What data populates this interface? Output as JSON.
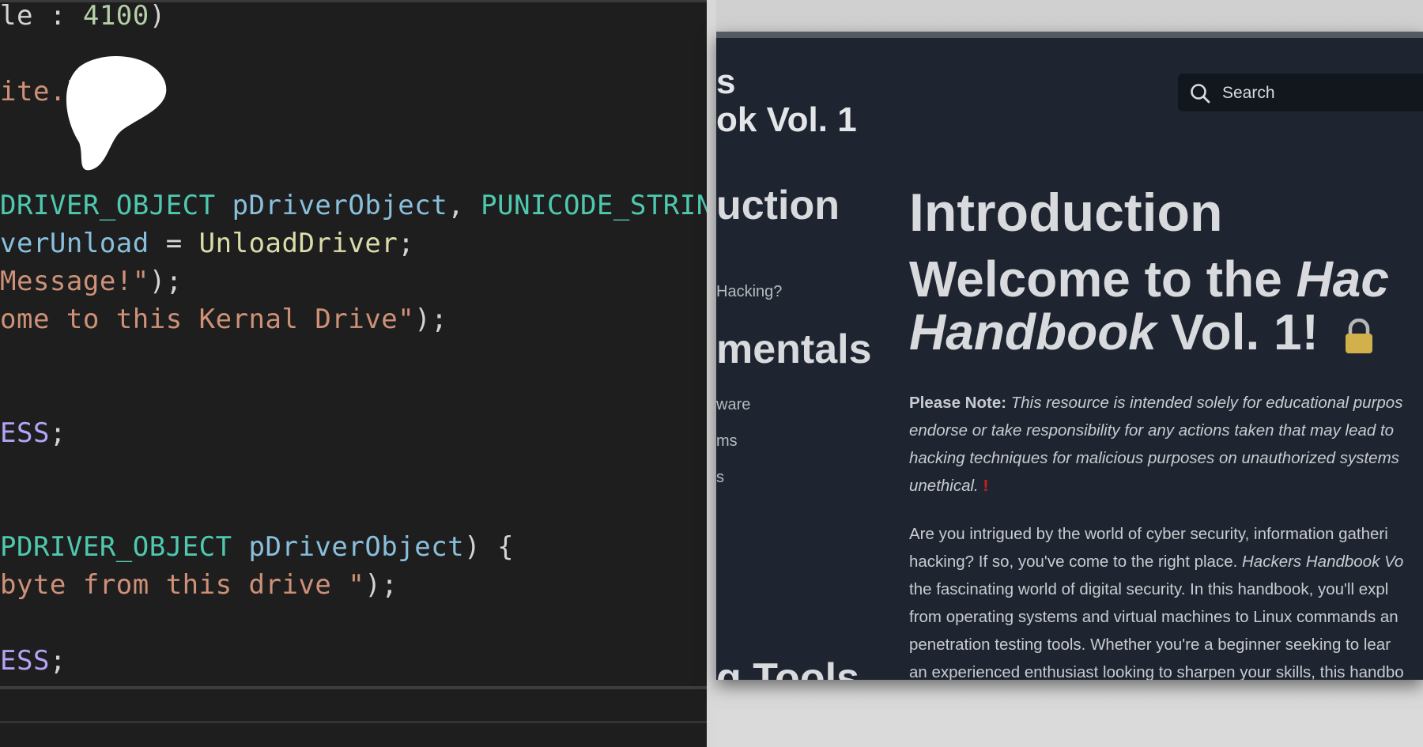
{
  "code": {
    "lines": [
      {
        "parts": [
          [
            "punc",
            "le : "
          ],
          [
            "num",
            "4100"
          ],
          [
            "punc",
            ")"
          ]
        ]
      },
      {
        "parts": [
          [
            "str",
            "ite.h"
          ]
        ]
      },
      {
        "parts": [
          [
            "type",
            "DRIVER_OBJECT"
          ],
          [
            "id",
            " pDriverObject"
          ],
          [
            "punc",
            ", "
          ],
          [
            "type",
            "PUNICODE_STRING"
          ]
        ]
      },
      {
        "parts": [
          [
            "id",
            "verUnload"
          ],
          [
            "punc",
            " = "
          ],
          [
            "fn",
            "UnloadDriver"
          ],
          [
            "punc",
            ";"
          ]
        ]
      },
      {
        "parts": [
          [
            "str",
            "Message!\""
          ],
          [
            "punc",
            ");"
          ]
        ]
      },
      {
        "parts": [
          [
            "str",
            "ome to this Kernal Drive\""
          ],
          [
            "punc",
            ");"
          ]
        ]
      },
      {
        "parts": [
          [
            "const",
            "ESS"
          ],
          [
            "punc",
            ";"
          ]
        ]
      },
      {
        "parts": [
          [
            "type",
            "PDRIVER_OBJECT"
          ],
          [
            "id",
            " pDriverObject"
          ],
          [
            "punc",
            ") {"
          ]
        ]
      },
      {
        "parts": [
          [
            "str",
            "byte from this drive \""
          ],
          [
            "punc",
            ");"
          ]
        ]
      },
      {
        "parts": [
          [
            "const",
            "ESS"
          ],
          [
            "punc",
            ";"
          ]
        ]
      }
    ]
  },
  "site": {
    "title_line1": "s",
    "title_line2": "ok Vol. 1",
    "search_placeholder": "Search"
  },
  "sidebar": {
    "items": [
      {
        "label": "uction",
        "kind": "heading"
      },
      {
        "label": "Hacking?",
        "kind": "sub"
      },
      {
        "label": "mentals",
        "kind": "heading"
      },
      {
        "label": "ware",
        "kind": "sub"
      },
      {
        "label": "ms",
        "kind": "sub"
      },
      {
        "label": "s",
        "kind": "sub"
      },
      {
        "label": "g Tools",
        "kind": "heading"
      }
    ]
  },
  "content": {
    "h1": "Introduction",
    "h2_part1": "Welcome to the ",
    "h2_part2": "Hac",
    "h2_part3": "Handbook",
    "h2_part4": " Vol. 1!",
    "note_label": "Please Note:",
    "note_lines": [
      " This resource is intended solely for educational purpos",
      "endorse or take responsibility for any actions taken that may lead to",
      "hacking techniques for malicious purposes on unauthorized systems",
      "unethical."
    ],
    "note_mark": "!",
    "para_line1": "Are you intrigued by the world of cyber security, information gatheri",
    "para_line2a": "hacking? If so, you've come to the right place. ",
    "para_line2b": "Hackers Handbook Vo",
    "para_lines_rest": [
      "the fascinating world of digital security. In this handbook, you'll expl",
      "from operating systems and virtual machines to Linux commands an",
      "penetration testing tools. Whether you're a beginner seeking to lear",
      "an experienced enthusiast looking to sharpen your skills, this handbo"
    ]
  }
}
